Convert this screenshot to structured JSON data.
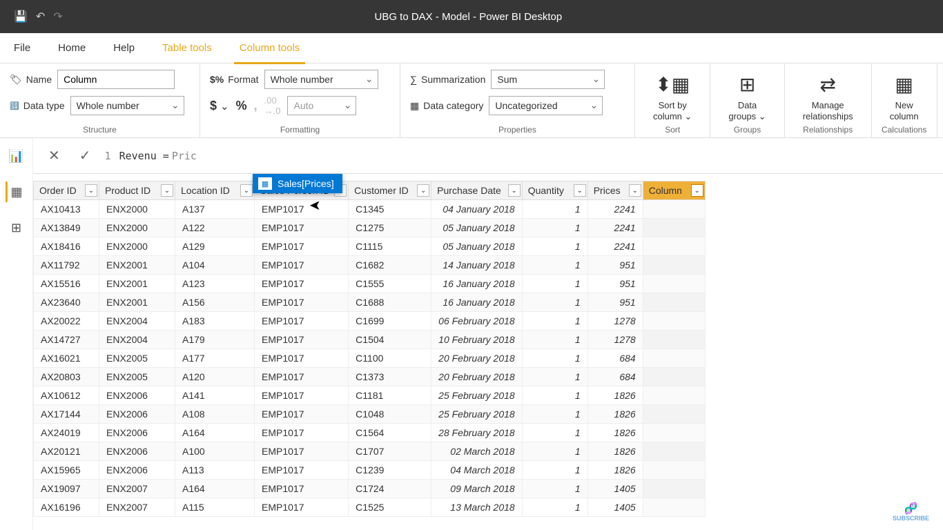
{
  "titlebar": {
    "title": "UBG to DAX - Model - Power BI Desktop"
  },
  "tabs": {
    "file": "File",
    "home": "Home",
    "help": "Help",
    "table_tools": "Table tools",
    "column_tools": "Column tools"
  },
  "structure": {
    "name_label": "Name",
    "name_value": "Column",
    "datatype_label": "Data type",
    "datatype_value": "Whole number",
    "group_label": "Structure"
  },
  "formatting": {
    "format_label": "Format",
    "format_value": "Whole number",
    "auto_placeholder": "Auto",
    "group_label": "Formatting"
  },
  "properties": {
    "summarization_label": "Summarization",
    "summarization_value": "Sum",
    "datacategory_label": "Data category",
    "datacategory_value": "Uncategorized",
    "group_label": "Properties"
  },
  "ribbon_buttons": {
    "sort": {
      "label": "Sort by\ncolumn ⌄",
      "group": "Sort"
    },
    "groups": {
      "label": "Data\ngroups ⌄",
      "group": "Groups"
    },
    "relationships": {
      "label": "Manage\nrelationships",
      "group": "Relationships"
    },
    "calculations": {
      "label": "New\ncolumn",
      "group": "Calculations"
    }
  },
  "formula": {
    "line_number": "1",
    "text_prefix": "Revenu = ",
    "text_typed": "Pric"
  },
  "autocomplete": {
    "suggestion": "Sales[Prices]"
  },
  "columns": [
    "Order ID",
    "Product ID",
    "Location ID",
    "Sales Person ID",
    "Customer ID",
    "Purchase Date",
    "Quantity",
    "Prices",
    "Column"
  ],
  "rows": [
    {
      "order": "AX10413",
      "product": "ENX2000",
      "location": "A137",
      "sales": "EMP1017",
      "customer": "C1345",
      "date": "04 January 2018",
      "qty": "1",
      "price": "2241"
    },
    {
      "order": "AX13849",
      "product": "ENX2000",
      "location": "A122",
      "sales": "EMP1017",
      "customer": "C1275",
      "date": "05 January 2018",
      "qty": "1",
      "price": "2241"
    },
    {
      "order": "AX18416",
      "product": "ENX2000",
      "location": "A129",
      "sales": "EMP1017",
      "customer": "C1115",
      "date": "05 January 2018",
      "qty": "1",
      "price": "2241"
    },
    {
      "order": "AX11792",
      "product": "ENX2001",
      "location": "A104",
      "sales": "EMP1017",
      "customer": "C1682",
      "date": "14 January 2018",
      "qty": "1",
      "price": "951"
    },
    {
      "order": "AX15516",
      "product": "ENX2001",
      "location": "A123",
      "sales": "EMP1017",
      "customer": "C1555",
      "date": "16 January 2018",
      "qty": "1",
      "price": "951"
    },
    {
      "order": "AX23640",
      "product": "ENX2001",
      "location": "A156",
      "sales": "EMP1017",
      "customer": "C1688",
      "date": "16 January 2018",
      "qty": "1",
      "price": "951"
    },
    {
      "order": "AX20022",
      "product": "ENX2004",
      "location": "A183",
      "sales": "EMP1017",
      "customer": "C1699",
      "date": "06 February 2018",
      "qty": "1",
      "price": "1278"
    },
    {
      "order": "AX14727",
      "product": "ENX2004",
      "location": "A179",
      "sales": "EMP1017",
      "customer": "C1504",
      "date": "10 February 2018",
      "qty": "1",
      "price": "1278"
    },
    {
      "order": "AX16021",
      "product": "ENX2005",
      "location": "A177",
      "sales": "EMP1017",
      "customer": "C1100",
      "date": "20 February 2018",
      "qty": "1",
      "price": "684"
    },
    {
      "order": "AX20803",
      "product": "ENX2005",
      "location": "A120",
      "sales": "EMP1017",
      "customer": "C1373",
      "date": "20 February 2018",
      "qty": "1",
      "price": "684"
    },
    {
      "order": "AX10612",
      "product": "ENX2006",
      "location": "A141",
      "sales": "EMP1017",
      "customer": "C1181",
      "date": "25 February 2018",
      "qty": "1",
      "price": "1826"
    },
    {
      "order": "AX17144",
      "product": "ENX2006",
      "location": "A108",
      "sales": "EMP1017",
      "customer": "C1048",
      "date": "25 February 2018",
      "qty": "1",
      "price": "1826"
    },
    {
      "order": "AX24019",
      "product": "ENX2006",
      "location": "A164",
      "sales": "EMP1017",
      "customer": "C1564",
      "date": "28 February 2018",
      "qty": "1",
      "price": "1826"
    },
    {
      "order": "AX20121",
      "product": "ENX2006",
      "location": "A100",
      "sales": "EMP1017",
      "customer": "C1707",
      "date": "02 March 2018",
      "qty": "1",
      "price": "1826"
    },
    {
      "order": "AX15965",
      "product": "ENX2006",
      "location": "A113",
      "sales": "EMP1017",
      "customer": "C1239",
      "date": "04 March 2018",
      "qty": "1",
      "price": "1826"
    },
    {
      "order": "AX19097",
      "product": "ENX2007",
      "location": "A164",
      "sales": "EMP1017",
      "customer": "C1724",
      "date": "09 March 2018",
      "qty": "1",
      "price": "1405"
    },
    {
      "order": "AX16196",
      "product": "ENX2007",
      "location": "A115",
      "sales": "EMP1017",
      "customer": "C1525",
      "date": "13 March 2018",
      "qty": "1",
      "price": "1405"
    }
  ],
  "col_widths": {
    "order": 95,
    "product": 110,
    "location": 115,
    "sales": 135,
    "customer": 120,
    "date": 130,
    "qty": 95,
    "price": 80,
    "column": 90
  },
  "subscribe": "SUBSCRIBE"
}
